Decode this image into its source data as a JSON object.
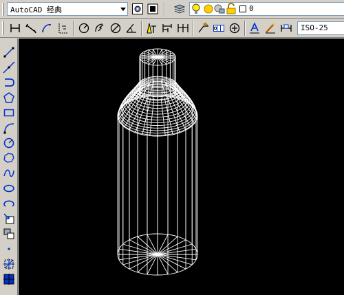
{
  "workspace": {
    "value": "AutoCAD 经典"
  },
  "layer": {
    "name": "0"
  },
  "dimstyle": {
    "value": "ISO-25"
  },
  "toolbar_top": {
    "icons": [
      "workspace-settings-icon",
      "customize-icon",
      "layer-manager-icon",
      "lightbulb-icon",
      "sun-icon",
      "freeze-icon",
      "lock-icon",
      "layer-color-swatch-icon"
    ]
  },
  "dimension_toolbar": {
    "icons": [
      "linear-dimension-icon",
      "aligned-dimension-icon",
      "arc-length-icon",
      "ordinate-dimension-icon",
      "radius-dimension-icon",
      "jogged-dimension-icon",
      "diameter-dimension-icon",
      "angular-dimension-icon",
      "quick-dimension-icon",
      "baseline-dimension-icon",
      "continue-dimension-icon",
      "quick-leader-icon",
      "tolerance-icon",
      "center-mark-icon",
      "dimension-edit-icon",
      "dimension-text-edit-icon",
      "dimension-update-icon"
    ]
  },
  "draw_toolbar": {
    "icons": [
      "line-icon",
      "construction-line-icon",
      "polyline-icon",
      "polygon-icon",
      "rectangle-icon",
      "arc-icon",
      "circle-icon",
      "revision-cloud-icon",
      "spline-icon",
      "ellipse-icon",
      "ellipse-arc-icon",
      "insert-block-icon",
      "make-block-icon",
      "point-icon",
      "hatch-icon",
      "gradient-icon"
    ]
  },
  "drawing": {
    "background": "#000000",
    "stroke": "#ffffff"
  },
  "colors": {
    "chrome": "#d4d0c8",
    "lightbulb": "#ffee00",
    "sun": "#ffd000",
    "accent": "#0033cc"
  }
}
